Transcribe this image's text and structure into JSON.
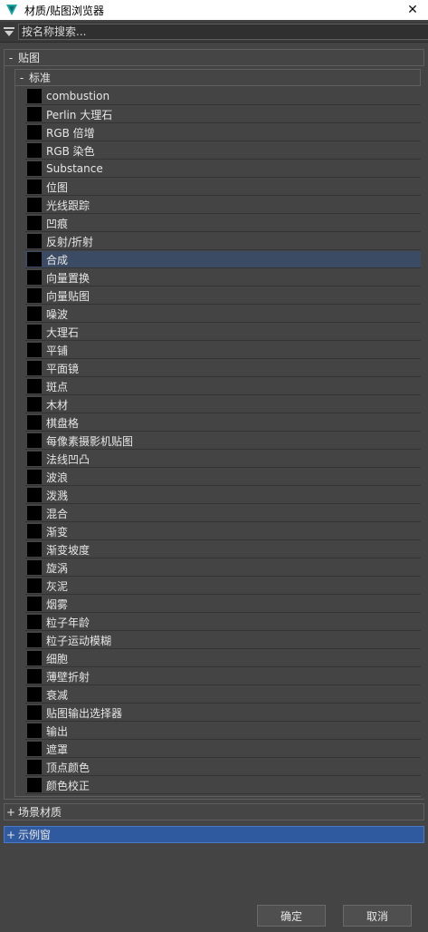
{
  "window": {
    "title": "材质/贴图浏览器",
    "close_glyph": "✕"
  },
  "search": {
    "placeholder": "按名称搜索..."
  },
  "groups": {
    "maps": {
      "sign": "-",
      "label": "贴图"
    },
    "standard": {
      "sign": "-",
      "label": "标准"
    },
    "scene_materials": {
      "sign": "+",
      "label": "场景材质"
    },
    "sample_slots": {
      "sign": "+",
      "label": "示例窗"
    }
  },
  "items": [
    {
      "label": "combustion",
      "thumb": "black"
    },
    {
      "label": "Perlin 大理石",
      "thumb": "perlin"
    },
    {
      "label": "RGB 倍增",
      "thumb": "white"
    },
    {
      "label": "RGB 染色",
      "thumb": "white"
    },
    {
      "label": "Substance",
      "thumb": "black"
    },
    {
      "label": "位图",
      "thumb": "black"
    },
    {
      "label": "光线跟踪",
      "thumb": "black"
    },
    {
      "label": "凹痕",
      "thumb": "dents"
    },
    {
      "label": "反射/折射",
      "thumb": "black"
    },
    {
      "label": "合成",
      "thumb": "black",
      "selected": true
    },
    {
      "label": "向量置换",
      "thumb": "black"
    },
    {
      "label": "向量贴图",
      "thumb": "mix"
    },
    {
      "label": "噪波",
      "thumb": "noise"
    },
    {
      "label": "大理石",
      "thumb": "marble"
    },
    {
      "label": "平铺",
      "thumb": "tile"
    },
    {
      "label": "平面镜",
      "thumb": "black"
    },
    {
      "label": "斑点",
      "thumb": "white"
    },
    {
      "label": "木材",
      "thumb": "wood"
    },
    {
      "label": "棋盘格",
      "thumb": "checker"
    },
    {
      "label": "每像素摄影机贴图",
      "thumb": "black"
    },
    {
      "label": "法线凹凸",
      "thumb": "normal"
    },
    {
      "label": "波浪",
      "thumb": "wave"
    },
    {
      "label": "泼溅",
      "thumb": "ripple"
    },
    {
      "label": "混合",
      "thumb": "black"
    },
    {
      "label": "渐变",
      "thumb": "gradient"
    },
    {
      "label": "渐变坡度",
      "thumb": "gradramp"
    },
    {
      "label": "旋涡",
      "thumb": "swirl"
    },
    {
      "label": "灰泥",
      "thumb": "stucco"
    },
    {
      "label": "烟雾",
      "thumb": "smoke"
    },
    {
      "label": "粒子年龄",
      "thumb": "black"
    },
    {
      "label": "粒子运动模糊",
      "thumb": "black"
    },
    {
      "label": "细胞",
      "thumb": "cellular"
    },
    {
      "label": "薄壁折射",
      "thumb": "black"
    },
    {
      "label": "衰减",
      "thumb": "falloff"
    },
    {
      "label": "贴图输出选择器",
      "thumb": "black"
    },
    {
      "label": "输出",
      "thumb": "white"
    },
    {
      "label": "遮罩",
      "thumb": "white"
    },
    {
      "label": "顶点颜色",
      "thumb": "vertex"
    },
    {
      "label": "颜色校正",
      "thumb": "black"
    }
  ],
  "buttons": {
    "ok": "确定",
    "cancel": "取消"
  },
  "colors": {
    "selection": "#3c4b64",
    "highlight_group": "#2f5aa0",
    "background": "#444444"
  }
}
